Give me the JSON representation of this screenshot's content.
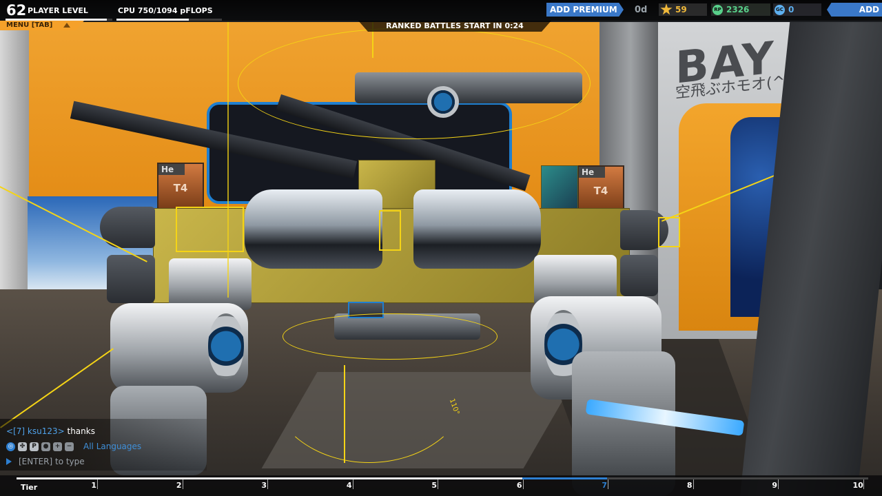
{
  "player": {
    "level": "62",
    "level_label": "PLAYER LEVEL",
    "level_progress": 0.95
  },
  "cpu": {
    "label": "CPU 750/1094 pFLOPS",
    "used": 750,
    "max": 1094
  },
  "premium": {
    "button_label": "ADD PREMIUM",
    "days_left": "0d"
  },
  "currencies": [
    {
      "icon": "star-icon",
      "value": "59",
      "color": "#f0b93a"
    },
    {
      "icon": "robit-icon",
      "icon_text": "RP",
      "value": "2326",
      "color": "#58d08a"
    },
    {
      "icon": "cosmetic-credit-icon",
      "icon_text": "GC",
      "value": "0",
      "color": "#5db0f0"
    }
  ],
  "funds": {
    "button_label": "ADD FUNDS"
  },
  "menu": {
    "label": "MENU [TAB]"
  },
  "ranked": {
    "text": "RANKED BATTLES START IN 0:24"
  },
  "garage": {
    "bay_sign": "BAY",
    "bay_subtitle": "空飛ぶホモオ(^o",
    "he_label": "He",
    "tier_mark": "T4",
    "angle_readout": "110°"
  },
  "chat": {
    "message": {
      "channel": "<[7]",
      "user": "ksu123>",
      "text": "thanks"
    },
    "icons": [
      "globe-icon",
      "clan-icon",
      "party-icon",
      "friend-icon",
      "add-friend-icon",
      "ignore-icon"
    ],
    "language_filter": "All Languages",
    "input_placeholder": "[ENTER] to type"
  },
  "tier_bar": {
    "label": "Tier",
    "ticks": [
      "1",
      "2",
      "3",
      "4",
      "5",
      "6",
      "7",
      "8",
      "9",
      "10"
    ],
    "current_tier": 7,
    "progress_fraction": 0.6
  },
  "colors": {
    "accent_blue": "#3a78c8",
    "menu_orange": "#f5a12a",
    "gizmo_yellow": "#f5d416"
  }
}
